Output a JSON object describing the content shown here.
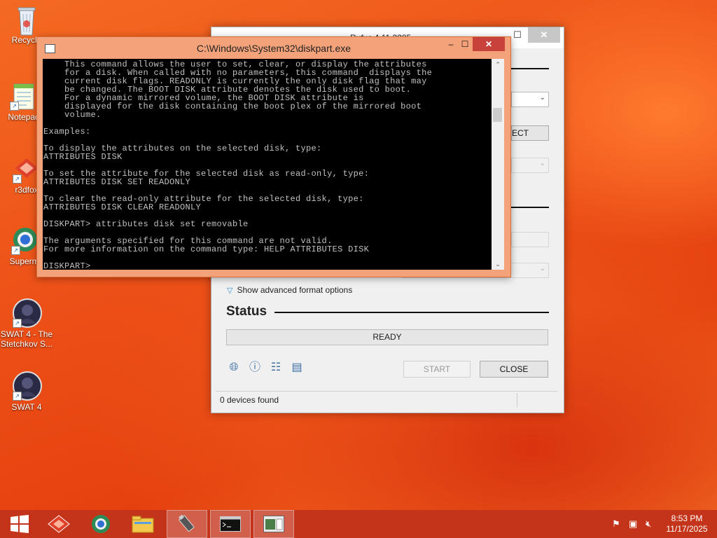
{
  "desktop": {
    "icons": [
      {
        "label": "Recycle"
      },
      {
        "label": "Notepad"
      },
      {
        "label": "r3dfox"
      },
      {
        "label": "Supermi"
      },
      {
        "label": "SWAT 4 - The Stetchkov S..."
      },
      {
        "label": "SWAT 4"
      }
    ]
  },
  "rufus": {
    "title": "Rufus 4.11.2285",
    "select_button": "SELECT",
    "advanced_toggle": "Show advanced format options",
    "status_heading": "Status",
    "progress_text": "READY",
    "start_button": "START",
    "close_button": "CLOSE",
    "footer_status": "0 devices found"
  },
  "console": {
    "title": "C:\\Windows\\System32\\diskpart.exe",
    "output": "    This command allows the user to set, clear, or display the attributes\n    for a disk. When called with no parameters, this command  displays the\n    current disk flags. READONLY is currently the only disk flag that may\n    be changed. The BOOT DISK attribute denotes the disk used to boot.\n    For a dynamic mirrored volume, the BOOT DISK attribute is\n    displayed for the disk containing the boot plex of the mirrored boot\n    volume.\n\nExamples:\n\nTo display the attributes on the selected disk, type:\nATTRIBUTES DISK\n\nTo set the attribute for the selected disk as read-only, type:\nATTRIBUTES DISK SET READONLY\n\nTo clear the read-only attribute for the selected disk, type:\nATTRIBUTES DISK CLEAR READONLY\n\nDISKPART> attributes disk set removable\n\nThe arguments specified for this command are not valid.\nFor more information on the command type: HELP ATTRIBUTES DISK\n\nDISKPART> "
  },
  "taskbar": {
    "clock_time": "8:53 PM",
    "clock_date": "11/17/2025"
  },
  "colors": {
    "accent": "#c7423a",
    "taskbar": "#c3341a",
    "console_bg": "#000000",
    "console_text": "#c0c0c0"
  }
}
